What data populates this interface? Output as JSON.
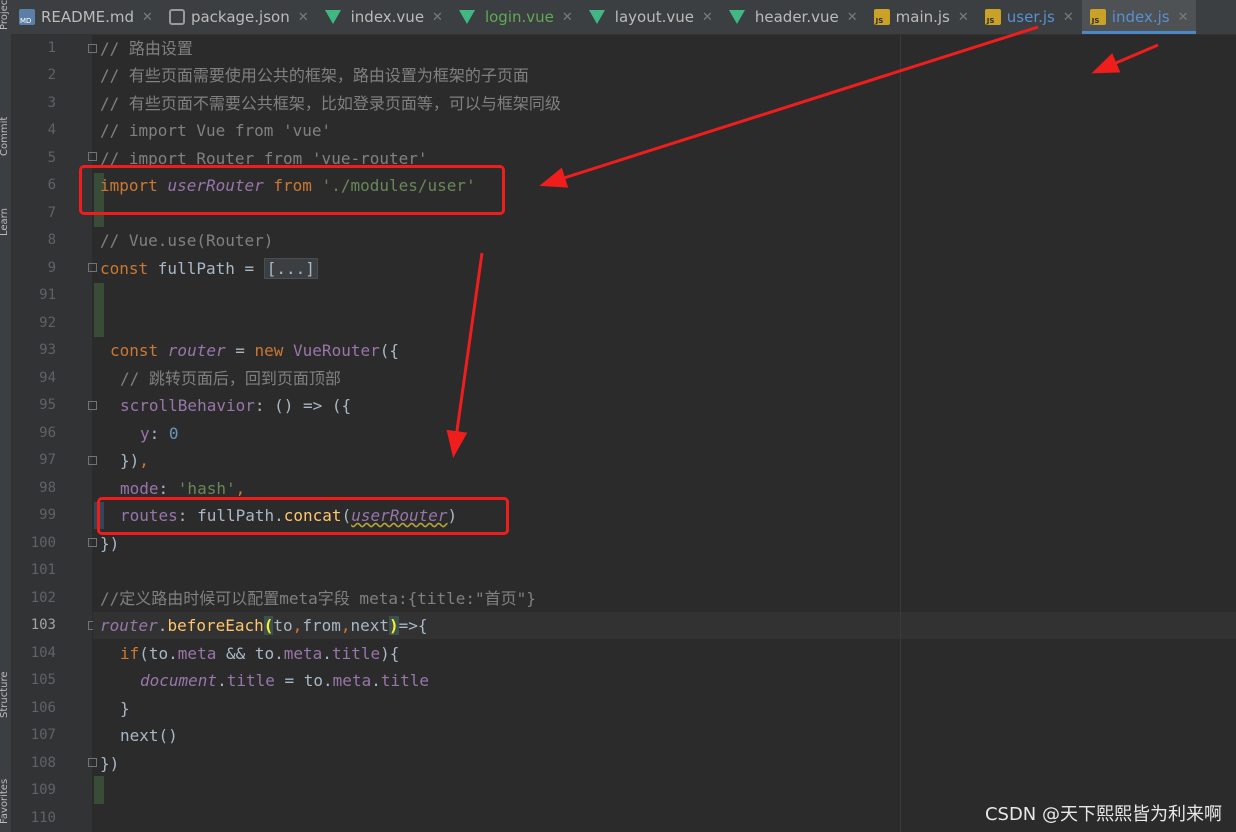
{
  "tabs": [
    {
      "label": "README.md",
      "icon": "markdown-file-icon",
      "style": "normal"
    },
    {
      "label": "package.json",
      "icon": "json-file-icon",
      "style": "normal"
    },
    {
      "label": "index.vue",
      "icon": "vue-file-icon",
      "style": "normal"
    },
    {
      "label": "login.vue",
      "icon": "vue-file-icon",
      "style": "green"
    },
    {
      "label": "layout.vue",
      "icon": "vue-file-icon",
      "style": "normal"
    },
    {
      "label": "header.vue",
      "icon": "vue-file-icon",
      "style": "normal"
    },
    {
      "label": "main.js",
      "icon": "js-file-icon",
      "style": "normal"
    },
    {
      "label": "user.js",
      "icon": "js-file-icon",
      "style": "blue"
    },
    {
      "label": "index.js",
      "icon": "js-file-icon",
      "style": "blue",
      "active": true
    }
  ],
  "tab_close_glyph": "✕",
  "side_panels": [
    "Project",
    "Commit",
    "Learn",
    "Structure",
    "Favorites"
  ],
  "line_numbers": [
    "1",
    "2",
    "3",
    "4",
    "5",
    "6",
    "7",
    "8",
    "9",
    "91",
    "92",
    "93",
    "94",
    "95",
    "96",
    "97",
    "98",
    "99",
    "100",
    "101",
    "102",
    "103",
    "104",
    "105",
    "106",
    "107",
    "108",
    "109",
    "110"
  ],
  "current_line": "103",
  "code": {
    "l1": "// 路由设置",
    "l2": "// 有些页面需要使用公共的框架，路由设置为框架的子页面",
    "l3": "// 有些页面不需要公共框架，比如登录页面等，可以与框架同级",
    "l4": "// import Vue from 'vue'",
    "l5": "// import Router from 'vue-router'",
    "l6": {
      "kw1": "import ",
      "name": "userRouter",
      "kw2": " from ",
      "str": "'./modules/user'"
    },
    "l8": "// Vue.use(Router)",
    "l9": {
      "kw": "const ",
      "name": "fullPath",
      "eq": " = ",
      "folded": "[...]"
    },
    "l93": {
      "kw1": "const ",
      "name": "router",
      "eq": " = ",
      "kw2": "new ",
      "cls": "VueRouter",
      "rest": "({"
    },
    "l94": "// 跳转页面后，回到页面顶部",
    "l95": {
      "prop": "scrollBehavior",
      "rest": ": () => ({"
    },
    "l96": {
      "prop": "y",
      "colon": ": ",
      "num": "0"
    },
    "l97": {
      "text": "})",
      "comma": ","
    },
    "l98": {
      "prop": "mode",
      "colon": ": ",
      "str": "'hash'",
      "comma": ","
    },
    "l99": {
      "prop": "routes",
      "colon": ": ",
      "obj": "fullPath.",
      "fn": "concat",
      "open": "(",
      "arg": "userRouter",
      "close": ")"
    },
    "l100": "})",
    "l102": "//定义路由时候可以配置meta字段 meta:{title:\"首页\"}",
    "l103": {
      "name": "router",
      "dot": ".",
      "fn": "beforeEach",
      "p1": "(",
      "args1": "to",
      ",1": ",",
      "args2": "from",
      ",2": ",",
      "args3": "next",
      "p2": ")",
      "rest": "=>{"
    },
    "l104": {
      "kw": "if",
      "a": "(to.",
      "p1": "meta",
      "b": " && to.",
      "p2": "meta",
      "c": ".",
      "p3": "title",
      "d": "){"
    },
    "l105": {
      "glob": "document",
      "a": ".",
      "p1": "title",
      "b": " = to.",
      "p2": "meta",
      "c": ".",
      "p3": "title"
    },
    "l106": "}",
    "l107": "next()",
    "l108": "})"
  },
  "watermark": "CSDN @天下熙熙皆为利来啊",
  "colors": {
    "annotation_red": "#f01d1d",
    "keyword": "#cc7832",
    "string": "#6a8759",
    "number": "#6897bb",
    "property": "#9876aa",
    "function": "#ffc66d",
    "comment": "#808080"
  }
}
